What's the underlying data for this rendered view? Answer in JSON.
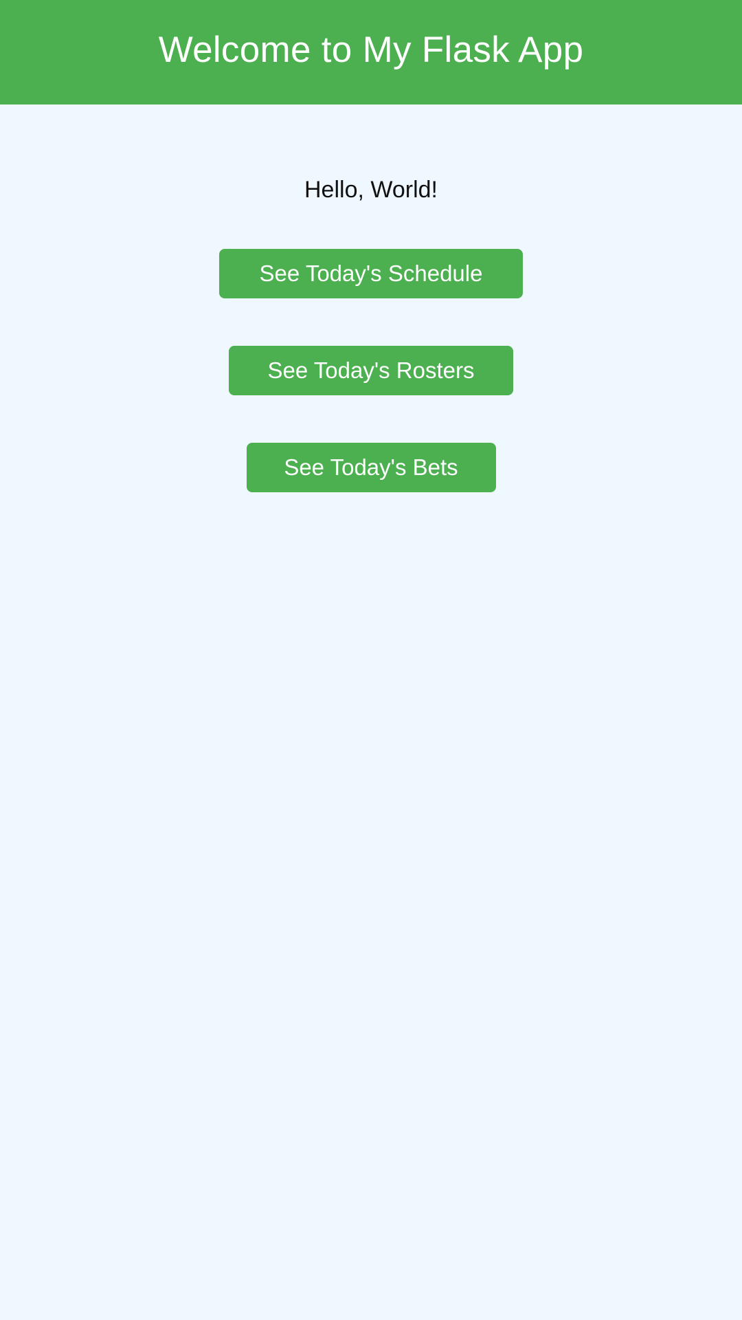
{
  "header": {
    "title": "Welcome to My Flask App"
  },
  "main": {
    "greeting": "Hello, World!",
    "buttons": {
      "schedule": "See Today's Schedule",
      "rosters": "See Today's Rosters",
      "bets": "See Today's Bets"
    }
  },
  "colors": {
    "accent": "#4caf50",
    "background": "#f0f8ff",
    "text": "#111111",
    "button_text": "#ffffff"
  }
}
